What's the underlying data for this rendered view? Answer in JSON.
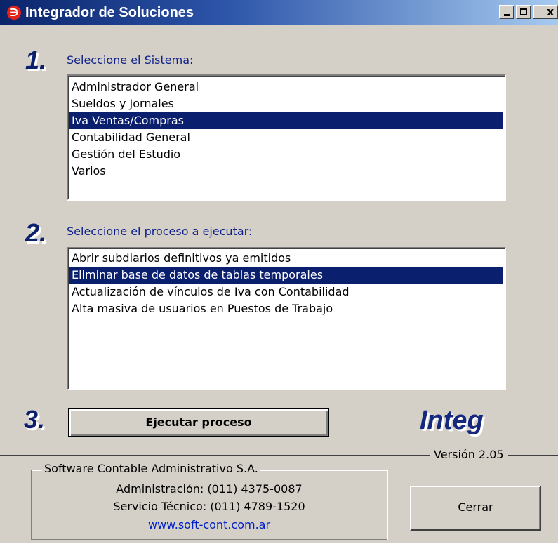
{
  "window": {
    "title": "Integrador de Soluciones",
    "icon": "app-logo-icon",
    "controls": [
      "minimize-icon",
      "maximize-icon",
      "close-icon"
    ],
    "close_glyph": "x"
  },
  "step1": {
    "number": "1.",
    "label": "Seleccione el Sistema:",
    "items": [
      "Administrador General",
      "Sueldos y Jornales",
      "Iva Ventas/Compras",
      "Contabilidad General",
      "Gestión del Estudio",
      "Varios"
    ],
    "selected_index": 2
  },
  "step2": {
    "number": "2.",
    "label": "Seleccione el proceso a ejecutar:",
    "items": [
      "Abrir subdiarios definitivos ya emitidos",
      "Eliminar base de datos de tablas temporales",
      "Actualización de vínculos de Iva con Contabilidad",
      "Alta masiva de usuarios en Puestos de Trabajo"
    ],
    "selected_index": 1
  },
  "step3": {
    "number": "3.",
    "button_accel": "E",
    "button_rest": "jecutar proceso"
  },
  "brand": {
    "logo": "Integ",
    "version": "Versión 2.05"
  },
  "company": {
    "name": "Software Contable Administrativo S.A.",
    "admin": "Administración: (011) 4375-0087",
    "support": "Servicio Técnico: (011) 4789-1520",
    "website": "www.soft-cont.com.ar"
  },
  "close_button": {
    "accel": "C",
    "rest": "errar"
  },
  "colors": {
    "selection": "#0a1f6e",
    "window_bg": "#d4d0c8",
    "label_blue": "#0c1f8a",
    "link_blue": "#0020c8",
    "title_bar_start": "#0a246a"
  }
}
